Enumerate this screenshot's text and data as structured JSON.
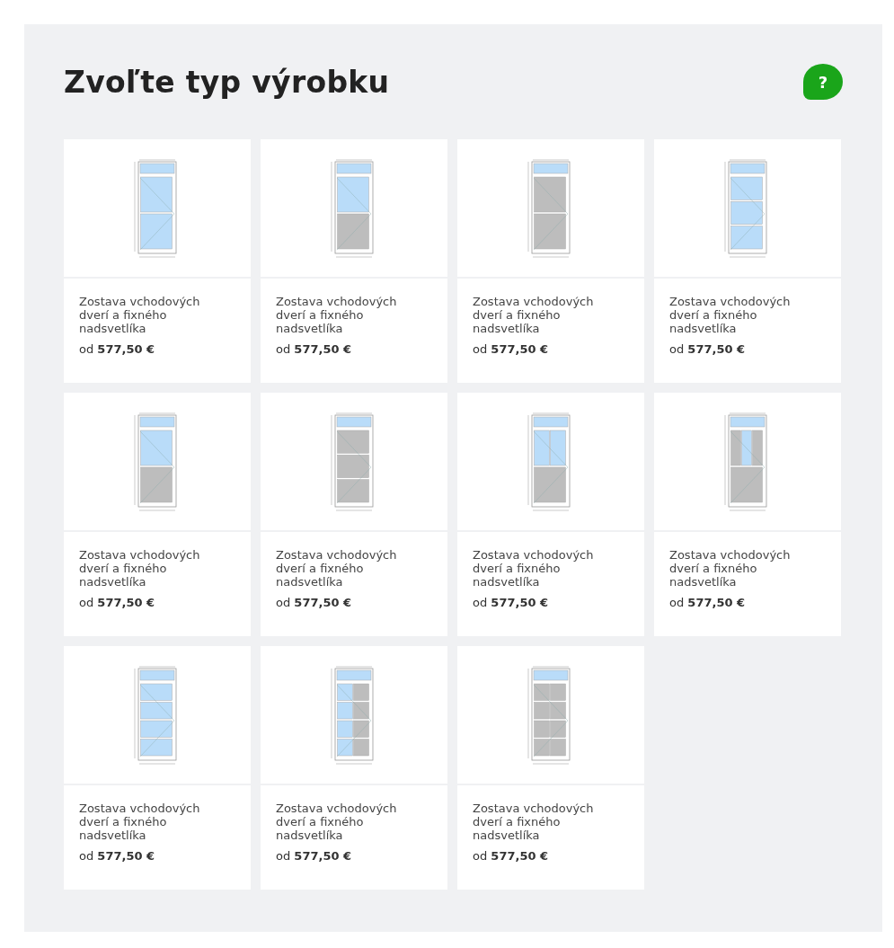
{
  "title": "Zvoľte typ výrobku",
  "help": {
    "label": "?"
  },
  "products": [
    {
      "name": "Zostava vchodových dverí a fixného nadsvetlíka",
      "price": "od **577,50 €**",
      "door": [
        [
          {
            "glazed": true
          }
        ],
        [
          {
            "glazed": true
          }
        ]
      ]
    },
    {
      "name": "Zostava vchodových dverí a fixného nadsvetlíka",
      "price": "od **577,50 €**",
      "door": [
        [
          {
            "glazed": true
          }
        ],
        [
          {
            "glazed": false
          }
        ]
      ]
    },
    {
      "name": "Zostava vchodových dverí a fixného nadsvetlíka",
      "price": "od **577,50 €**",
      "door": [
        [
          {
            "glazed": false
          }
        ],
        [
          {
            "glazed": false
          }
        ]
      ]
    },
    {
      "name": "Zostava vchodových dverí a fixného nadsvetlíka",
      "price": "od **577,50 €**",
      "door": [
        [
          {
            "glazed": true
          }
        ],
        [
          {
            "glazed": true
          }
        ],
        [
          {
            "glazed": true
          }
        ]
      ]
    },
    {
      "name": "Zostava vchodových dverí a fixného nadsvetlíka",
      "price": "od **577,50 €**",
      "door": [
        [
          {
            "glazed": true
          }
        ],
        [
          {
            "glazed": false
          }
        ]
      ]
    },
    {
      "name": "Zostava vchodových dverí a fixného nadsvetlíka",
      "price": "od **577,50 €**",
      "door": [
        [
          {
            "glazed": false
          }
        ],
        [
          {
            "glazed": false
          }
        ],
        [
          {
            "glazed": false
          }
        ]
      ]
    },
    {
      "name": "Zostava vchodových dverí a fixného nadsvetlíka",
      "price": "od **577,50 €**",
      "door": [
        [
          {
            "glazed": true
          },
          {
            "glazed": true
          }
        ],
        [
          {
            "glazed": false
          }
        ]
      ]
    },
    {
      "name": "Zostava vchodových dverí a fixného nadsvetlíka",
      "price": "od **577,50 €**",
      "door": [
        [
          {
            "glazed": false
          },
          {
            "glazed": true
          },
          {
            "glazed": false
          }
        ],
        [
          {
            "glazed": false
          }
        ]
      ]
    },
    {
      "name": "Zostava vchodových dverí a fixného nadsvetlíka",
      "price": "od **577,50 €**",
      "door": [
        [
          {
            "glazed": true
          }
        ],
        [
          {
            "glazed": true
          }
        ],
        [
          {
            "glazed": true
          }
        ],
        [
          {
            "glazed": true
          }
        ]
      ]
    },
    {
      "name": "Zostava vchodových dverí a fixného nadsvetlíka",
      "price": "od **577,50 €**",
      "door": [
        [
          {
            "glazed": true
          },
          {
            "glazed": false
          }
        ],
        [
          {
            "glazed": true
          },
          {
            "glazed": false
          }
        ],
        [
          {
            "glazed": true
          },
          {
            "glazed": false
          }
        ],
        [
          {
            "glazed": true
          },
          {
            "glazed": false
          }
        ]
      ]
    },
    {
      "name": "Zostava vchodových dverí a fixného nadsvetlíka",
      "price": "od **577,50 €**",
      "door": [
        [
          {
            "glazed": false
          },
          {
            "glazed": false
          }
        ],
        [
          {
            "glazed": false
          },
          {
            "glazed": false
          }
        ],
        [
          {
            "glazed": false
          },
          {
            "glazed": false
          }
        ],
        [
          {
            "glazed": false
          },
          {
            "glazed": false
          }
        ]
      ]
    }
  ]
}
